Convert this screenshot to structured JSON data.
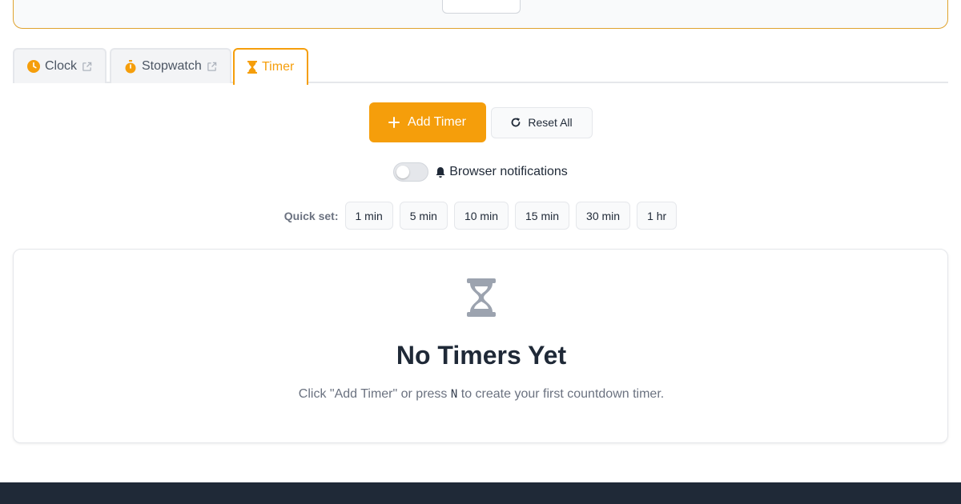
{
  "tabs": [
    {
      "label": "Clock",
      "icon": "clock-icon",
      "external": true
    },
    {
      "label": "Stopwatch",
      "icon": "stopwatch-icon",
      "external": true
    },
    {
      "label": "Timer",
      "icon": "hourglass-icon",
      "active": true
    }
  ],
  "actions": {
    "add_timer_label": "Add Timer",
    "reset_all_label": "Reset All"
  },
  "notifications": {
    "label": "Browser notifications",
    "enabled": false,
    "icon": "bell-icon"
  },
  "quick_set": {
    "label": "Quick set:",
    "options": [
      "1 min",
      "5 min",
      "10 min",
      "15 min",
      "30 min",
      "1 hr"
    ]
  },
  "empty_state": {
    "icon": "hourglass-icon",
    "title": "No Timers Yet",
    "desc_before": "Click \"Add Timer\" or press ",
    "key": "N",
    "desc_after": " to create your first countdown timer."
  },
  "colors": {
    "accent": "#f59e0b",
    "footer": "#1f2937"
  }
}
